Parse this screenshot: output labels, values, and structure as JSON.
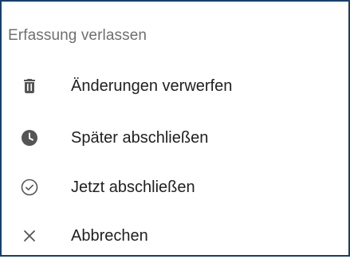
{
  "dialog": {
    "title": "Erfassung verlassen",
    "items": [
      {
        "label": "Änderungen verwerfen",
        "icon": "trash-icon"
      },
      {
        "label": "Später abschließen",
        "icon": "clock-icon"
      },
      {
        "label": "Jetzt abschließen",
        "icon": "check-circle-icon"
      },
      {
        "label": "Abbrechen",
        "icon": "close-icon"
      }
    ]
  },
  "colors": {
    "border": "#1a3e68",
    "title_text": "#6f6f6f",
    "item_text": "#1f1f1f",
    "icon": "#555555"
  }
}
